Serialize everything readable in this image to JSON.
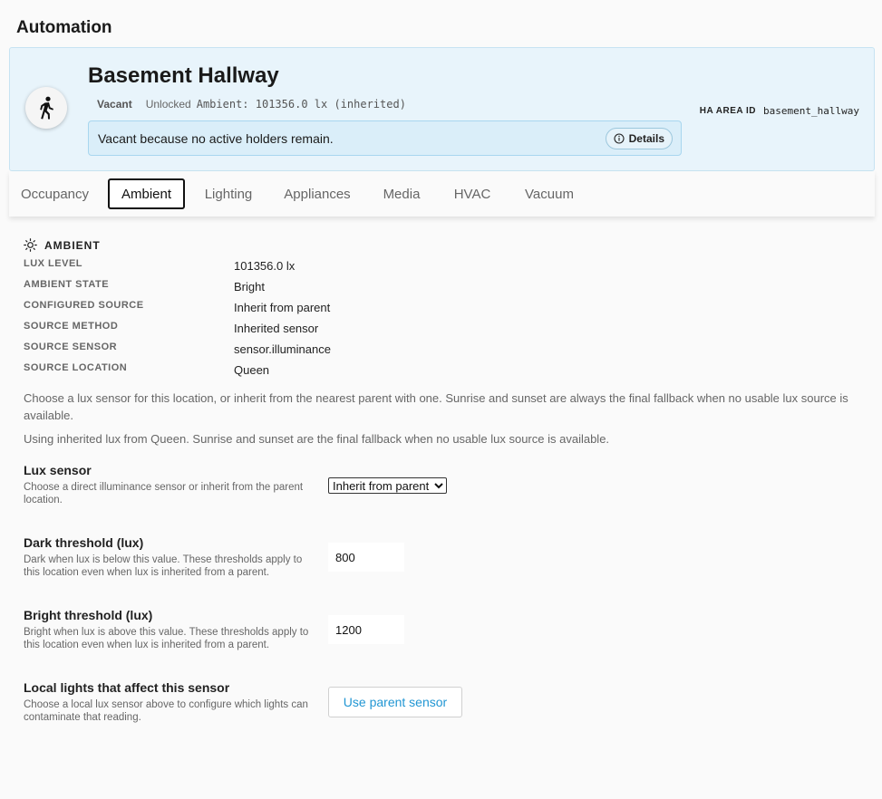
{
  "page": {
    "title": "Automation"
  },
  "header": {
    "area_name": "Basement Hallway",
    "occupancy": "Vacant",
    "lock_state": "Unlocked",
    "ambient_inline": "Ambient: 101356.0 lx (inherited)",
    "reason": "Vacant because no active holders remain.",
    "details_label": "Details",
    "ha_area_label": "HA AREA ID",
    "ha_area_value": "basement_hallway",
    "avatar_icon": "walking-person-icon"
  },
  "tabs": [
    {
      "label": "Occupancy",
      "active": false
    },
    {
      "label": "Ambient",
      "active": true
    },
    {
      "label": "Lighting",
      "active": false
    },
    {
      "label": "Appliances",
      "active": false
    },
    {
      "label": "Media",
      "active": false
    },
    {
      "label": "HVAC",
      "active": false
    },
    {
      "label": "Vacuum",
      "active": false
    }
  ],
  "ambient": {
    "section_title": "AMBIENT",
    "section_icon": "sun-icon",
    "rows": [
      {
        "label": "LUX LEVEL",
        "value": "101356.0 lx"
      },
      {
        "label": "AMBIENT STATE",
        "value": "Bright"
      },
      {
        "label": "CONFIGURED SOURCE",
        "value": "Inherit from parent"
      },
      {
        "label": "SOURCE METHOD",
        "value": "Inherited sensor"
      },
      {
        "label": "SOURCE SENSOR",
        "value": "sensor.illuminance"
      },
      {
        "label": "SOURCE LOCATION",
        "value": "Queen"
      }
    ],
    "help_1": "Choose a lux sensor for this location, or inherit from the nearest parent with one. Sunrise and sunset are always the final fallback when no usable lux source is available.",
    "help_2": "Using inherited lux from Queen. Sunrise and sunset are the final fallback when no usable lux source is available."
  },
  "settings": {
    "lux_sensor": {
      "label": "Lux sensor",
      "desc": "Choose a direct illuminance sensor or inherit from the parent location.",
      "selected": "Inherit from parent"
    },
    "dark_threshold": {
      "label": "Dark threshold (lux)",
      "desc": "Dark when lux is below this value. These thresholds apply to this location even when lux is inherited from a parent.",
      "value": "800"
    },
    "bright_threshold": {
      "label": "Bright threshold (lux)",
      "desc": "Bright when lux is above this value. These thresholds apply to this location even when lux is inherited from a parent.",
      "value": "1200"
    },
    "local_lights": {
      "label": "Local lights that affect this sensor",
      "desc": "Choose a local lux sensor above to configure which lights can contaminate that reading.",
      "button": "Use parent sensor"
    }
  },
  "colors": {
    "accent": "#2196d3",
    "header_bg": "#e8f4fb",
    "reason_bg": "#daeef9"
  }
}
